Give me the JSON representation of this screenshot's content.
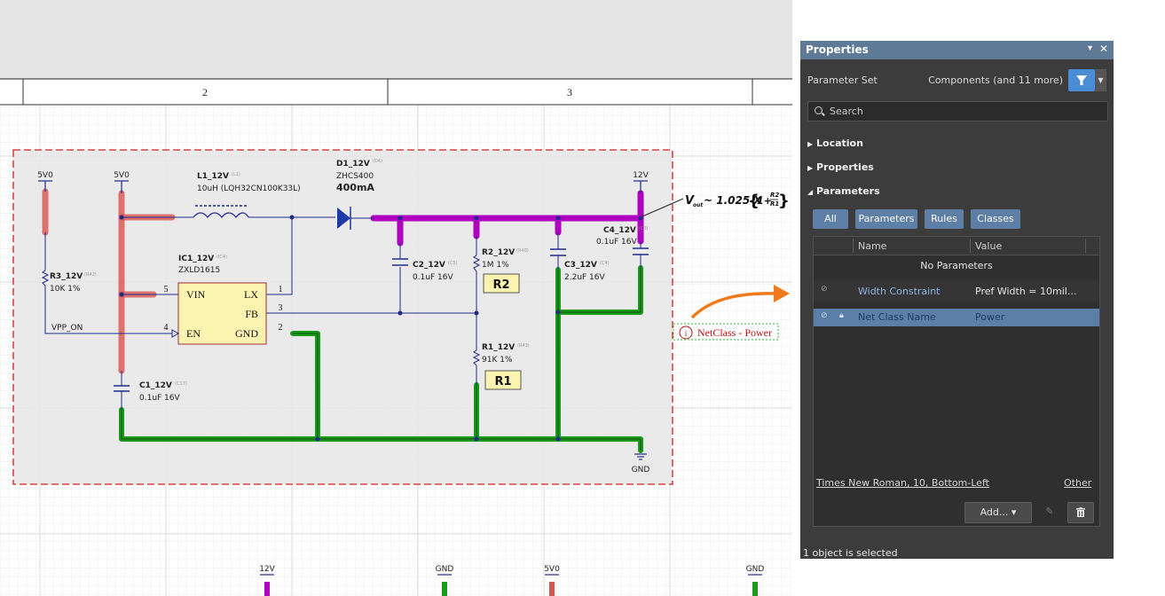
{
  "schematic": {
    "zone_numbers": [
      "2",
      "3"
    ],
    "power_ports": {
      "p5v0_a": "5V0",
      "p5v0_b": "5V0",
      "p12v": "12V",
      "gnd": "GND"
    },
    "bottom_ports": [
      "12V",
      "GND",
      "5V0",
      "GND"
    ],
    "components": {
      "l1": {
        "designator": "L1_12V",
        "tag": "(L1)",
        "value": "10uH (LQH32CN100K33L)"
      },
      "d1": {
        "designator": "D1_12V",
        "tag": "(D4)",
        "part": "ZHCS400",
        "rating": "400mA"
      },
      "ic1": {
        "designator": "IC1_12V",
        "tag": "(IC4)",
        "part": "ZXLD1615",
        "pins_left": [
          "VIN",
          "EN"
        ],
        "pins_right": [
          "LX",
          "FB",
          "GND"
        ],
        "pin_numbers": [
          "5",
          "4",
          "1",
          "3",
          "2"
        ]
      },
      "r3": {
        "designator": "R3_12V",
        "tag": "(R42)",
        "value": "10K 1%"
      },
      "c1": {
        "designator": "C1_12V",
        "tag": "(C17)",
        "value": "0.1uF 16V"
      },
      "c2": {
        "designator": "C2_12V",
        "tag": "(C5)",
        "value": "0.1uF 16V"
      },
      "r2": {
        "designator": "R2_12V",
        "tag": "(R40)",
        "value": "1M 1%",
        "label": "R2"
      },
      "r1": {
        "designator": "R1_12V",
        "tag": "(R43)",
        "value": "91K 1%",
        "label": "R1"
      },
      "c3": {
        "designator": "C3_12V",
        "tag": "(C4)",
        "value": "2.2uF 16V"
      },
      "c4": {
        "designator": "C4_12V",
        "tag": "(C3)",
        "value": "0.1uF 16V"
      }
    },
    "net_label_vpp": "VPP_ON",
    "formula": {
      "vout": "V",
      "sub": "out",
      "rest": " ~ 1.025 X",
      "one": "1+",
      "num": "R2",
      "den": "R1"
    },
    "netclass_label": "NetClass - Power",
    "colors": {
      "power_net": "#b000c0",
      "gnd_net": "#1a9a1a",
      "supply_5v": "#d9534f",
      "accent_arrow": "#f07a1a",
      "wire": "#1e2a8c"
    }
  },
  "panel": {
    "title": "Properties",
    "pin_icon": "▾",
    "close_icon": "✕",
    "parameter_set_label": "Parameter Set",
    "parameter_set_value": "Components (and 11 more)",
    "search_placeholder": "Search",
    "sections": [
      "Location",
      "Properties",
      "Parameters"
    ],
    "tabs": [
      "All",
      "Parameters",
      "Rules",
      "Classes"
    ],
    "grid_headers": [
      "Name",
      "Value"
    ],
    "no_params": "No Parameters",
    "rows": [
      {
        "name": "Width Constraint",
        "value": "Pref Width = 10mil..."
      },
      {
        "name": "Net Class Name",
        "value": "Power"
      }
    ],
    "font_link": "Times New Roman, 10, Bottom-Left",
    "other_link": "Other",
    "add_label": "Add...",
    "add_arrow": "▾",
    "status": "1 object is selected"
  }
}
